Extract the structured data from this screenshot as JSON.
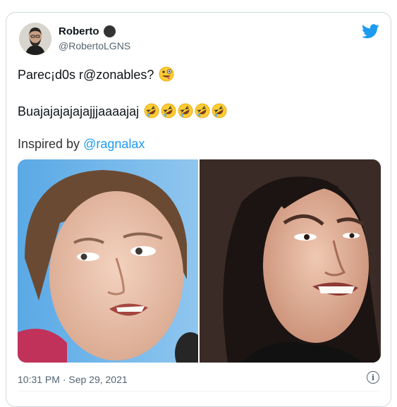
{
  "author": {
    "name": "Roberto",
    "handle": "@RobertoLGNS"
  },
  "tweet": {
    "line1": "Parec¡d0s r@zonables?",
    "line1_emoji": "zany-face",
    "line2": "Buajajajajajajjjaaaajaj",
    "line2_emojis": [
      "rolling-on-floor-laughing",
      "rolling-on-floor-laughing",
      "rolling-on-floor-laughing",
      "rolling-on-floor-laughing",
      "rolling-on-floor-laughing"
    ],
    "inspired_prefix": "Inspired by",
    "mention": "@ragnalax"
  },
  "timestamp": "10:31 PM · Sep 29, 2021",
  "icons": {
    "brand": "twitter-bird-icon",
    "info": "info-icon",
    "verified": "badge-icon"
  },
  "colors": {
    "twitter_blue": "#1d9bf0",
    "text": "#0f1419",
    "muted": "#536471",
    "border": "#cfd9de"
  }
}
